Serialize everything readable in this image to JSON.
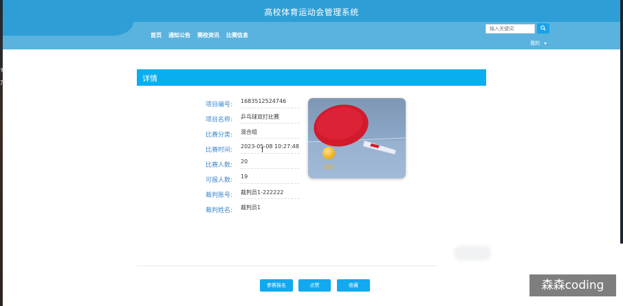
{
  "header": {
    "site_title": "高校体育运动会管理系统",
    "nav": [
      "首页",
      "通知公告",
      "赛校资讯",
      "比赛信息"
    ],
    "search": {
      "placeholder": "输入关键词",
      "icon": "search-icon"
    },
    "user_menu": {
      "label": "我的",
      "icon": "caret-down-icon"
    }
  },
  "detail": {
    "title": "详情",
    "fields": [
      {
        "label": "项目编号:",
        "value": "1683512524746"
      },
      {
        "label": "项目名称:",
        "value": "乒乓球双打比赛"
      },
      {
        "label": "比赛分类:",
        "value": "混合组"
      },
      {
        "label": "比赛时间:",
        "value": "2023-05-08 10:27:48"
      },
      {
        "label": "比赛人数:",
        "value": "20"
      },
      {
        "label": "可报人数:",
        "value": "19"
      },
      {
        "label": "裁判账号:",
        "value": "裁判员1-222222"
      },
      {
        "label": "裁判姓名:",
        "value": "裁判员1"
      }
    ],
    "image": {
      "subject": "ping-pong paddle and ball"
    }
  },
  "actions": [
    "参赛报名",
    "点赞",
    "收藏"
  ],
  "watermark": "森森coding",
  "colors": {
    "header": "#2d9fd6",
    "accent": "#09aef0",
    "label": "#3a87c9"
  }
}
